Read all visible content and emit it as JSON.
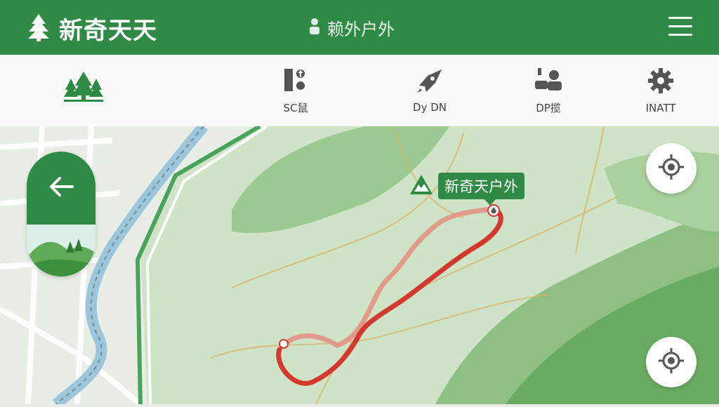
{
  "app": {
    "name": "新奇天天",
    "subtitle": "赖外户外"
  },
  "nav": {
    "items": [
      {
        "label": "",
        "icon": "forest-icon"
      },
      {
        "label": "SC鼠",
        "icon": "map-grid-icon"
      },
      {
        "label": "Dy DN",
        "icon": "rocket-icon"
      },
      {
        "label": "DP揽",
        "icon": "group-icon"
      },
      {
        "label": "INATT",
        "icon": "settings-gear-icon"
      }
    ]
  },
  "map": {
    "callout_label": "新奇天户外",
    "callout_icon": "mountain-icon"
  },
  "colors": {
    "brand_green": "#2f8a45",
    "route_red": "#d23a30",
    "route_pink": "#e29a8b"
  }
}
